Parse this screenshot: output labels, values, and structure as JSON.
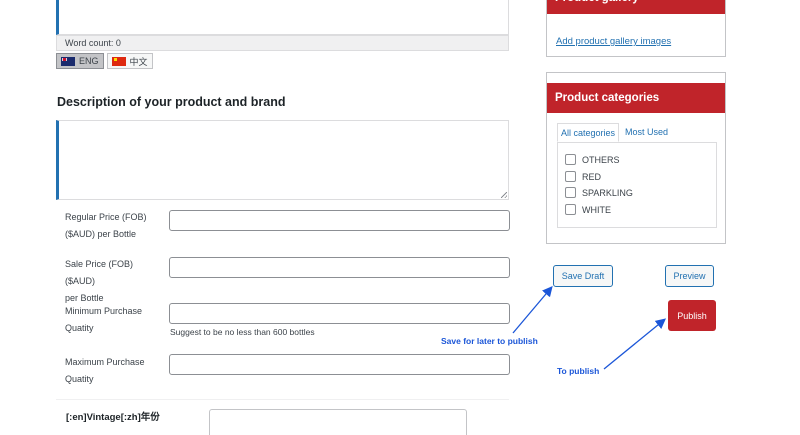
{
  "editor": {
    "word_count": "Word count: 0",
    "languages": [
      {
        "label": "ENG",
        "flag": "australia-flag-icon",
        "active": true
      },
      {
        "label": "中文",
        "flag": "china-flag-icon",
        "active": false
      }
    ]
  },
  "description": {
    "heading": "Description of your product and brand"
  },
  "fields": {
    "regular_price": {
      "label_line1": "Regular Price (FOB)",
      "label_line2": "($AUD) per Bottle",
      "value": ""
    },
    "sale_price": {
      "label_line1": "Sale Price (FOB) ($AUD)",
      "label_line2": "per Bottle",
      "value": ""
    },
    "min_purchase": {
      "label_line1": "Minimum Purchase",
      "label_line2": "Quatity",
      "value": "",
      "hint": "Suggest to be no less than 600 bottles"
    },
    "max_purchase": {
      "label_line1": "Maximum Purchase",
      "label_line2": "Quatity",
      "value": ""
    },
    "vintage": {
      "label": "[:en]Vintage[:zh]年份",
      "value": ""
    }
  },
  "sidebar": {
    "gallery": {
      "title": "Product gallery",
      "link": "Add product gallery images"
    },
    "categories": {
      "title": "Product categories",
      "tabs": [
        "All categories",
        "Most Used"
      ],
      "items": [
        "OTHERS",
        "RED",
        "SPARKLING",
        "WHITE"
      ]
    },
    "buttons": {
      "save_draft": "Save Draft",
      "preview": "Preview",
      "publish": "Publish"
    }
  },
  "annotations": {
    "save_note": "Save for later to publish",
    "publish_note": "To publish"
  },
  "colors": {
    "accent_blue": "#2271b1",
    "header_red": "#c0242a",
    "annotation_blue": "#1b56d8"
  }
}
